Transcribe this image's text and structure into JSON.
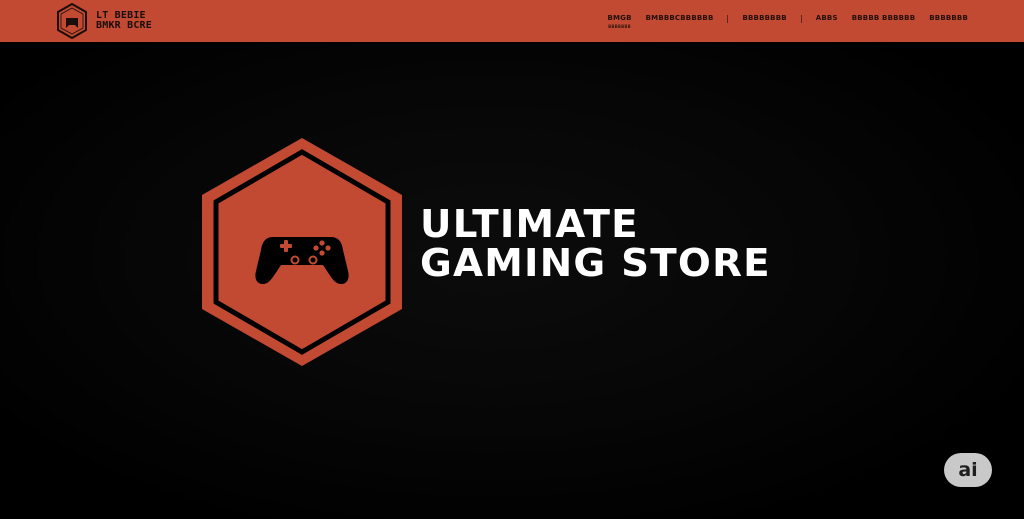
{
  "colors": {
    "accent": "#c24a33",
    "background": "#000000",
    "title_text": "#ffffff",
    "ai_badge": "#c9c9c9"
  },
  "header": {
    "logo_icon": "hexagon-controller-icon",
    "brand_line1": "LT BEBIE",
    "brand_line2": "BMKR BCRE",
    "nav": [
      {
        "label": "BMGB",
        "sub": "BBBBBBB"
      },
      {
        "label": "BMBBBCBBBBBB"
      },
      {
        "label": "BBBBBBBB"
      },
      {
        "label": "ABBS"
      },
      {
        "label": "BBBBB BBBBBB"
      },
      {
        "label": "BBBBBBB"
      }
    ]
  },
  "hero": {
    "emblem_icon": "gamepad-hexagon-icon",
    "title_line1": "ULTIMATE",
    "title_line2": "GAMING STORE"
  },
  "badge": {
    "label": "ai"
  }
}
